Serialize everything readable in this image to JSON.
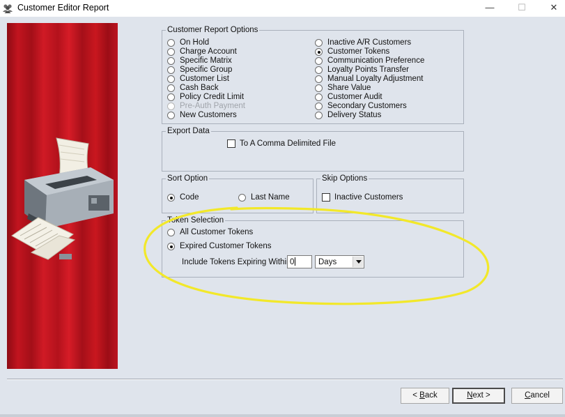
{
  "window": {
    "title": "Customer Editor Report",
    "app_icon": "people-icon",
    "controls": {
      "minimize": "—",
      "maximize": "☐",
      "close": "✕"
    }
  },
  "sidepanel": {
    "image": "printer-icon",
    "accent_color": "#c4141e"
  },
  "customer_report_options": {
    "legend": "Customer Report Options",
    "left": [
      {
        "label": "On Hold",
        "selected": false,
        "enabled": true
      },
      {
        "label": "Charge Account",
        "selected": false,
        "enabled": true
      },
      {
        "label": "Specific Matrix",
        "selected": false,
        "enabled": true
      },
      {
        "label": "Specific Group",
        "selected": false,
        "enabled": true
      },
      {
        "label": "Customer List",
        "selected": false,
        "enabled": true
      },
      {
        "label": "Cash Back",
        "selected": false,
        "enabled": true
      },
      {
        "label": "Policy Credit Limit",
        "selected": false,
        "enabled": true
      },
      {
        "label": "Pre-Auth Payment",
        "selected": false,
        "enabled": false
      },
      {
        "label": "New Customers",
        "selected": false,
        "enabled": true
      }
    ],
    "right": [
      {
        "label": "Inactive A/R Customers",
        "selected": false,
        "enabled": true
      },
      {
        "label": "Customer Tokens",
        "selected": true,
        "enabled": true
      },
      {
        "label": "Communication Preference",
        "selected": false,
        "enabled": true
      },
      {
        "label": "Loyalty Points Transfer",
        "selected": false,
        "enabled": true
      },
      {
        "label": "Manual Loyalty Adjustment",
        "selected": false,
        "enabled": true
      },
      {
        "label": "Share Value",
        "selected": false,
        "enabled": true
      },
      {
        "label": "Customer Audit",
        "selected": false,
        "enabled": true
      },
      {
        "label": "Secondary Customers",
        "selected": false,
        "enabled": true
      },
      {
        "label": "Delivery Status",
        "selected": false,
        "enabled": true
      }
    ]
  },
  "export_data": {
    "legend": "Export Data",
    "comma_file": {
      "label": "To A Comma Delimited File",
      "checked": false
    }
  },
  "sort_option": {
    "legend": "Sort Option",
    "code": {
      "label": "Code",
      "selected": true
    },
    "last_name": {
      "label": "Last Name",
      "selected": false
    }
  },
  "skip_options": {
    "legend": "Skip Options",
    "inactive": {
      "label": "Inactive Customers",
      "checked": false
    }
  },
  "token_selection": {
    "legend": "Token Selection",
    "all": {
      "label": "All Customer Tokens",
      "selected": false
    },
    "expired": {
      "label": "Expired Customer Tokens",
      "selected": true
    },
    "include_label": "Include Tokens Expiring Within",
    "include_value": "0",
    "period": "Days"
  },
  "annotation_color": "#f2e82a",
  "buttons": {
    "back_u": "B",
    "back_rest": "ack",
    "back_prefix": "< ",
    "next_u": "N",
    "next_rest": "ext >",
    "cancel_u": "C",
    "cancel_rest": "ancel"
  }
}
